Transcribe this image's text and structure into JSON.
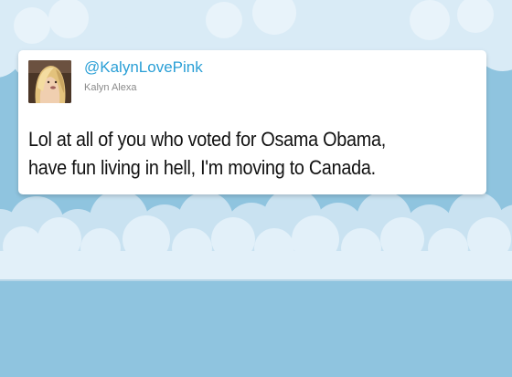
{
  "tweet": {
    "handle": "@KalynLovePink",
    "display_name": "Kalyn Alexa",
    "text_lines": [
      "Lol at all of you who voted for Osama Obama,",
      "have fun living in hell, I'm moving to Canada."
    ],
    "avatar_icon": "profile-photo"
  },
  "colors": {
    "background_sky": "#8fc4df",
    "cloud": "#dcedf8",
    "handle": "#2a9fd6",
    "card": "#ffffff",
    "text": "#111111"
  }
}
